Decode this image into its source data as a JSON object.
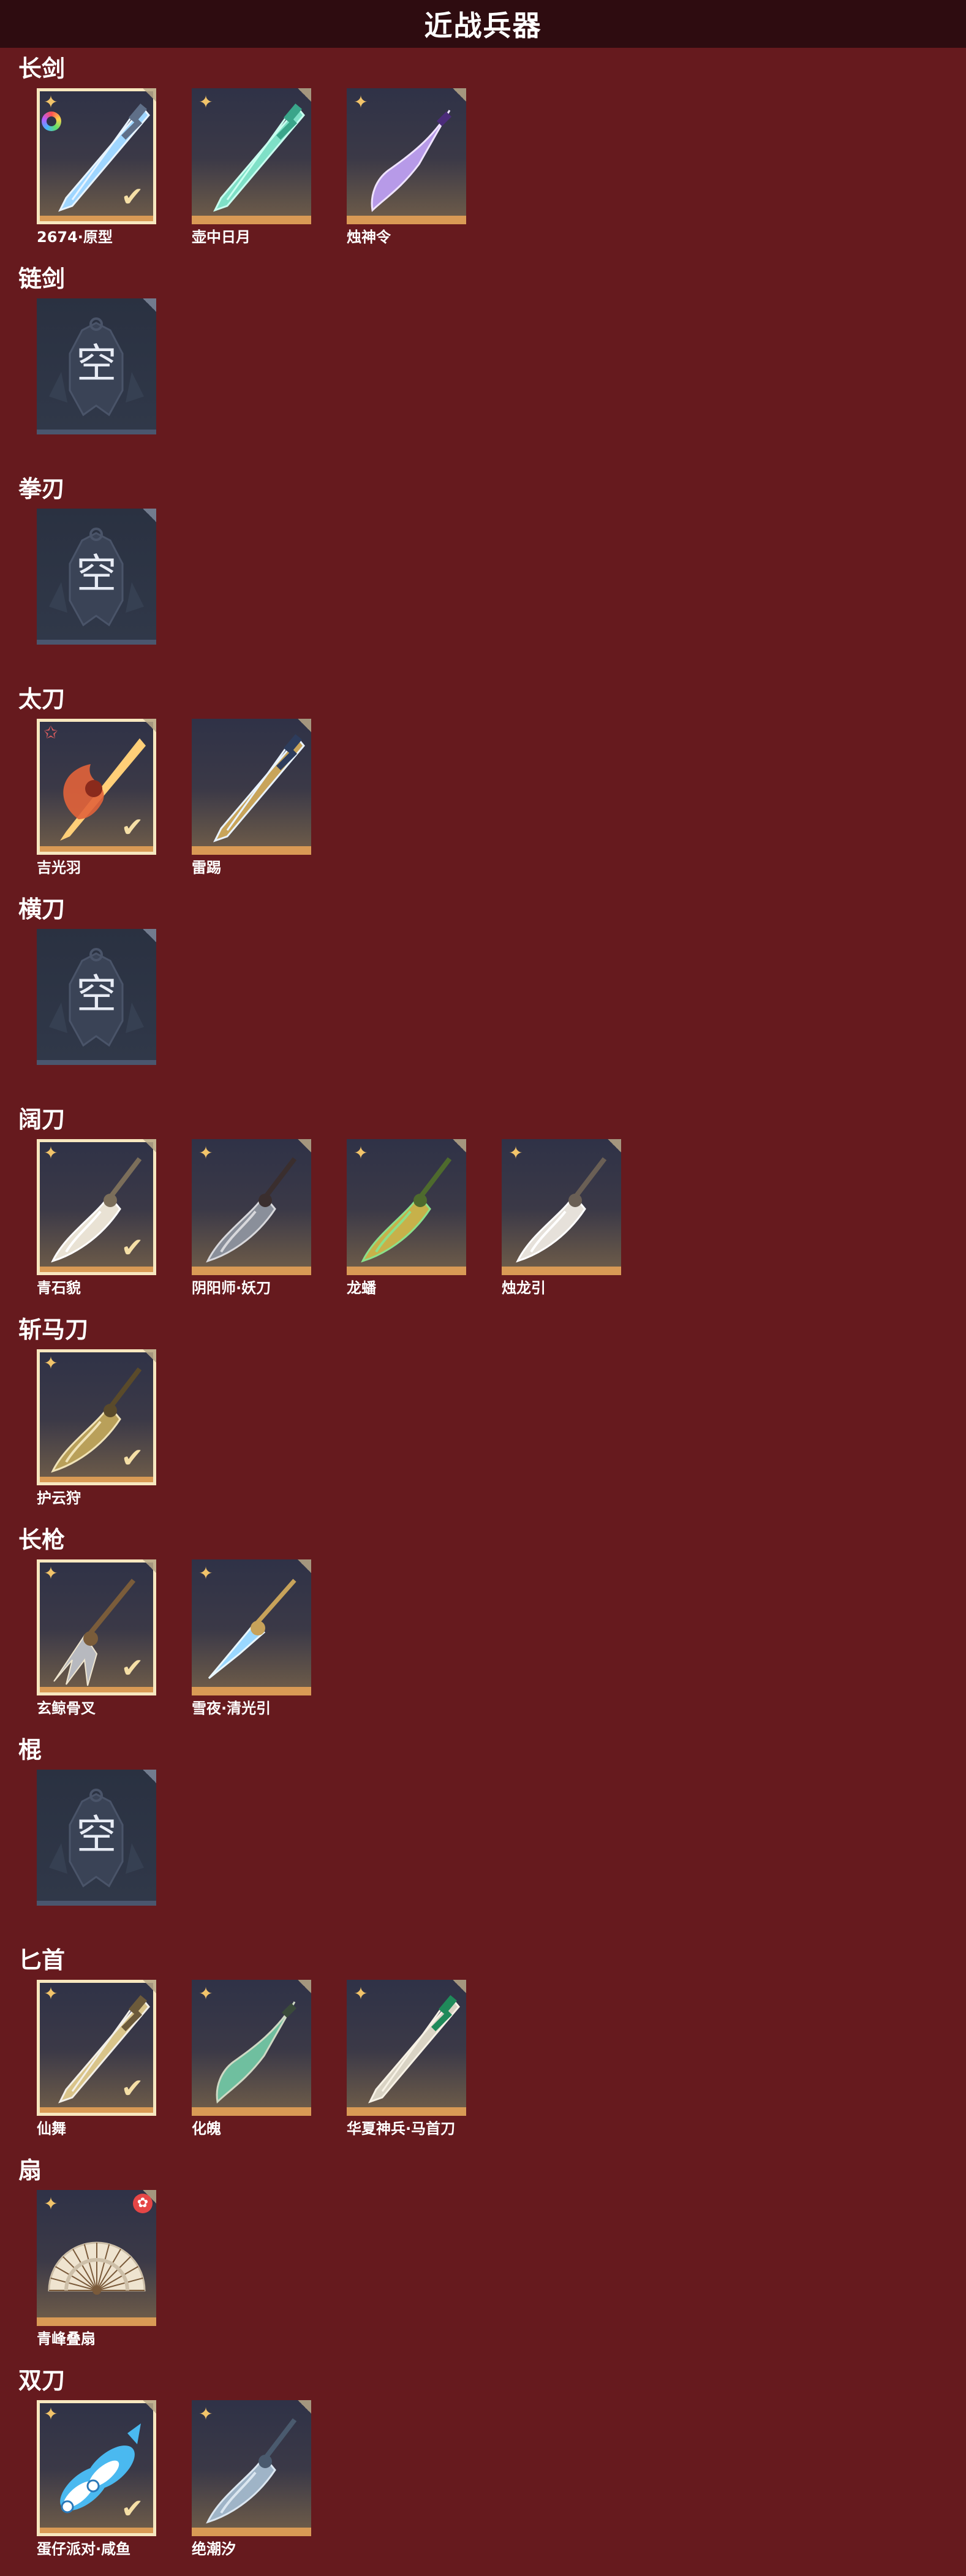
{
  "page": {
    "title": "近战兵器",
    "empty_label": "空"
  },
  "colors": {
    "background": "#661a1e",
    "header": "#2e0c10",
    "frame_accent": "#d99a55",
    "selected_outline": "#f7e7bf"
  },
  "categories": [
    {
      "title": "长剑",
      "items": [
        {
          "name": "2674·原型",
          "selected": true,
          "rarity_icon": "gold-star-icon",
          "extra_icon": "rainbow-ring-icon",
          "art": "blue-sword"
        },
        {
          "name": "壶中日月",
          "selected": false,
          "rarity_icon": "gold-star-icon",
          "art": "jade-sword"
        },
        {
          "name": "烛神令",
          "selected": false,
          "rarity_icon": "gold-star-icon",
          "art": "purple-sword"
        }
      ]
    },
    {
      "title": "链剑",
      "items": []
    },
    {
      "title": "拳刃",
      "items": []
    },
    {
      "title": "太刀",
      "items": [
        {
          "name": "吉光羽",
          "selected": true,
          "rarity_icon": "red-star-icon",
          "art": "flame-katana"
        },
        {
          "name": "雷踢",
          "selected": false,
          "rarity_icon": "",
          "art": "gold-katana"
        }
      ]
    },
    {
      "title": "横刀",
      "items": []
    },
    {
      "title": "阔刀",
      "items": [
        {
          "name": "青石貌",
          "selected": true,
          "rarity_icon": "gold-star-icon",
          "art": "white-broadblade"
        },
        {
          "name": "阴阳师·妖刀",
          "selected": false,
          "rarity_icon": "gold-star-icon",
          "art": "dark-broadblade"
        },
        {
          "name": "龙蟠",
          "selected": false,
          "rarity_icon": "gold-star-icon",
          "art": "gold-green-broadblade"
        },
        {
          "name": "烛龙引",
          "selected": false,
          "rarity_icon": "gold-star-icon",
          "art": "silver-broadblade"
        }
      ]
    },
    {
      "title": "斩马刀",
      "items": [
        {
          "name": "护云狩",
          "selected": true,
          "rarity_icon": "gold-star-icon",
          "art": "gold-poleblade"
        }
      ]
    },
    {
      "title": "长枪",
      "items": [
        {
          "name": "玄鲸骨叉",
          "selected": true,
          "rarity_icon": "gold-star-icon",
          "art": "trident"
        },
        {
          "name": "雪夜·清光引",
          "selected": false,
          "rarity_icon": "gold-star-icon",
          "art": "ice-spear"
        }
      ]
    },
    {
      "title": "棍",
      "items": []
    },
    {
      "title": "匕首",
      "items": [
        {
          "name": "仙舞",
          "selected": true,
          "rarity_icon": "gold-star-icon",
          "art": "gold-dagger"
        },
        {
          "name": "化魄",
          "selected": false,
          "rarity_icon": "gold-star-icon",
          "art": "curved-dagger"
        },
        {
          "name": "华夏神兵·马首刀",
          "selected": false,
          "rarity_icon": "gold-star-icon",
          "art": "ivory-dagger"
        }
      ]
    },
    {
      "title": "扇",
      "items": [
        {
          "name": "青峰叠扇",
          "selected": false,
          "rarity_icon": "gold-star-icon",
          "badge_icon": "red-flower-icon",
          "art": "folding-fan"
        }
      ]
    },
    {
      "title": "双刀",
      "items": [
        {
          "name": "蛋仔派对·咸鱼",
          "selected": true,
          "rarity_icon": "gold-star-icon",
          "art": "fish-blades"
        },
        {
          "name": "绝潮汐",
          "selected": false,
          "rarity_icon": "gold-star-icon",
          "art": "coral-blades"
        }
      ]
    }
  ]
}
